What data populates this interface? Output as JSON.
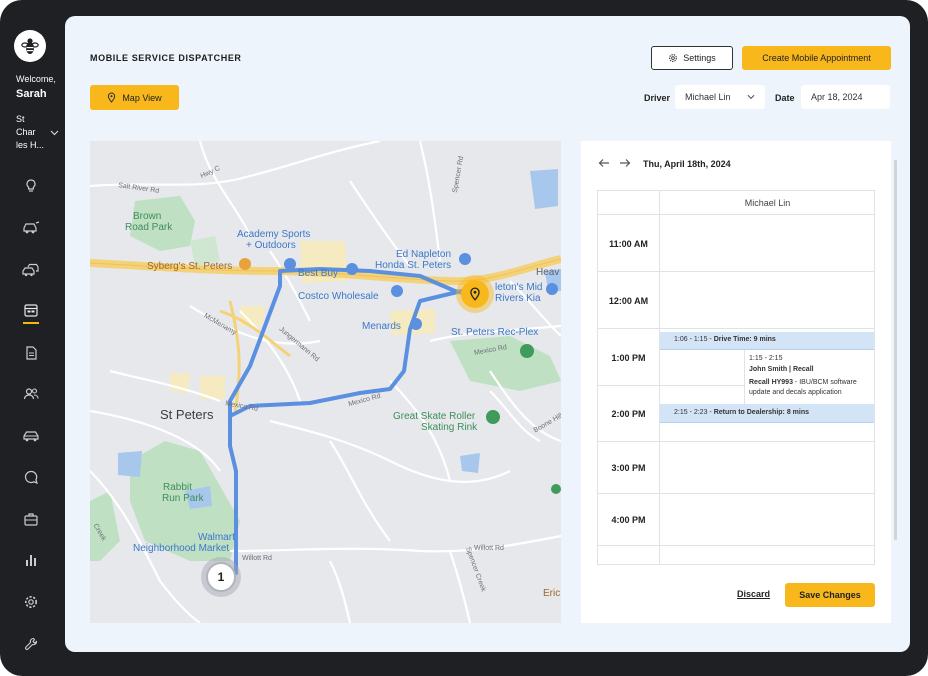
{
  "sidebar": {
    "welcome": "Welcome,",
    "user_name": "Sarah",
    "location_line1": "St",
    "location_line2": "Char",
    "location_line3": "les H...",
    "items": [
      {
        "icon": "lightbulb-icon"
      },
      {
        "icon": "car-service-icon"
      },
      {
        "icon": "cars-icon"
      },
      {
        "icon": "calendar-dispatch-icon",
        "active": true
      },
      {
        "icon": "document-icon"
      },
      {
        "icon": "users-icon"
      },
      {
        "icon": "car-icon"
      },
      {
        "icon": "chat-icon"
      },
      {
        "icon": "briefcase-icon"
      },
      {
        "icon": "bar-chart-icon"
      },
      {
        "icon": "gear-icon"
      },
      {
        "icon": "wrench-icon"
      }
    ]
  },
  "header": {
    "title": "MOBILE SERVICE DISPATCHER",
    "settings_label": "Settings",
    "create_label": "Create Mobile Appointment",
    "map_view_label": "Map View",
    "driver_label": "Driver",
    "driver_value": "Michael Lin",
    "date_label": "Date",
    "date_value": "Apr 18, 2024"
  },
  "map": {
    "labels": {
      "hwy_c": "Hwy C",
      "salt_river": "Salt River Rd",
      "spencer": "Spencer Rd",
      "brown_road_park1": "Brown",
      "brown_road_park2": "Road Park",
      "academy1": "Academy Sports",
      "academy2": "+ Outdoors",
      "ed_napleton1": "Ed Napleton",
      "ed_napleton2": "Honda St. Peters",
      "heavy": "Heav",
      "sybergs": "Syberg's St. Peters",
      "best_buy": "Best Buy",
      "costco": "Costco Wholesale",
      "mid_rivers1": "leton's Mid",
      "mid_rivers2": "Rivers Kia",
      "mcmenamy": "McMenamy",
      "menards": "Menards",
      "rec_plex": "St. Peters Rec-Plex",
      "jungermann": "Jungermann Rd",
      "mexico_rd1": "Mexico Rd",
      "mexico_rd2": "Mexico Rd",
      "mexico_rd3": "Mexico Rd",
      "st_peters": "St Peters",
      "great_skate1": "Great Skate Roller",
      "great_skate2": "Skating Rink",
      "boone": "Boone Hills",
      "rabbit1": "Rabbit",
      "rabbit2": "Run Park",
      "walmart1": "Walmart",
      "walmart2": "Neighborhood Market",
      "willott1": "Willott Rd",
      "willott2": "Willott Rd",
      "spencer_creek": "Spencer Creek",
      "erie": "Eric",
      "creek": "Creek"
    },
    "start_marker": "1"
  },
  "calendar": {
    "date_heading": "Thu, April 18th, 2024",
    "column_header": "Michael Lin",
    "times": [
      "11:00 AM",
      "12:00 AM",
      "1:00 PM",
      "2:00 PM",
      "3:00 PM",
      "4:00 PM"
    ],
    "events": {
      "drive1_time": "1:06 - 1:15 -",
      "drive1_title": "Drive Time: 9 mins",
      "recall_time": "1:15 - 2:15",
      "recall_customer": "John Smith | Recall",
      "recall_code": "Recall HY993",
      "recall_desc": " - IBU/BCM software update and decals application",
      "drive2_time": "2:15 - 2:23 -",
      "drive2_title": "Return to Dealership: 8 mins"
    },
    "discard_label": "Discard",
    "save_label": "Save Changes"
  },
  "colors": {
    "accent": "#f8b81c",
    "sidebar_bg": "#1e2024",
    "content_bg": "#eef4fb",
    "route": "#5b8fe0",
    "event_bg": "#d3e4f7"
  }
}
